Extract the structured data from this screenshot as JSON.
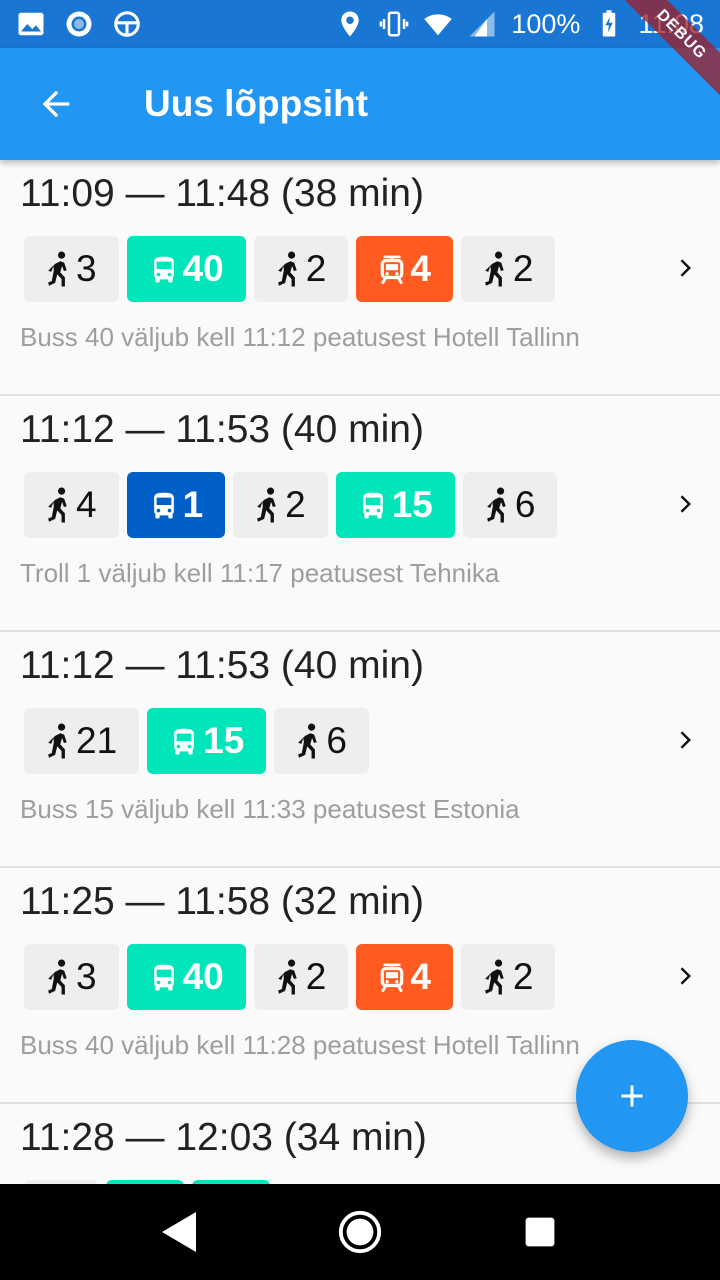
{
  "status_bar": {
    "battery": "100%",
    "time": "11:08",
    "left_icons": [
      "image-icon",
      "circle-icon",
      "steering-icon"
    ],
    "right_icons": [
      "location-icon",
      "vibrate-icon",
      "wifi-icon",
      "signal-icon",
      "battery-charging-icon"
    ]
  },
  "debug_banner": "DEBUG",
  "app_bar": {
    "title": "Uus lõppsiht"
  },
  "colors": {
    "primary": "#2196f3",
    "bus": "#00e5b9",
    "trolley": "#0060c8",
    "tram": "#ff5a1f",
    "walk": "#eeeeee"
  },
  "routes": [
    {
      "time": "11:09 — 11:48 (38 min)",
      "legs": [
        {
          "type": "walk",
          "label": "3"
        },
        {
          "type": "bus",
          "label": "40"
        },
        {
          "type": "walk",
          "label": "2"
        },
        {
          "type": "tram",
          "label": "4"
        },
        {
          "type": "walk",
          "label": "2"
        }
      ],
      "desc": "Buss 40 väljub kell 11:12 peatusest Hotell Tallinn"
    },
    {
      "time": "11:12 — 11:53 (40 min)",
      "legs": [
        {
          "type": "walk",
          "label": "4"
        },
        {
          "type": "trolley",
          "label": "1"
        },
        {
          "type": "walk",
          "label": "2"
        },
        {
          "type": "bus",
          "label": "15"
        },
        {
          "type": "walk",
          "label": "6"
        }
      ],
      "desc": "Troll 1 väljub kell 11:17 peatusest Tehnika"
    },
    {
      "time": "11:12 — 11:53 (40 min)",
      "legs": [
        {
          "type": "walk",
          "label": "21"
        },
        {
          "type": "bus",
          "label": "15"
        },
        {
          "type": "walk",
          "label": "6"
        }
      ],
      "desc": "Buss 15 väljub kell 11:33 peatusest Estonia"
    },
    {
      "time": "11:25 — 11:58 (32 min)",
      "legs": [
        {
          "type": "walk",
          "label": "3"
        },
        {
          "type": "bus",
          "label": "40"
        },
        {
          "type": "walk",
          "label": "2"
        },
        {
          "type": "tram",
          "label": "4"
        },
        {
          "type": "walk",
          "label": "2"
        }
      ],
      "desc": "Buss 40 väljub kell 11:28 peatusest Hotell Tallinn"
    },
    {
      "time": "11:28 — 12:03 (34 min)",
      "legs": [
        {
          "type": "walk",
          "label": ""
        },
        {
          "type": "bus",
          "label": ""
        },
        {
          "type": "bus",
          "label": ""
        }
      ],
      "desc": ""
    }
  ],
  "fab": {
    "icon": "plus-icon"
  },
  "nav_bar": {
    "icons": [
      "back-triangle-icon",
      "home-circle-icon",
      "recents-square-icon"
    ]
  }
}
